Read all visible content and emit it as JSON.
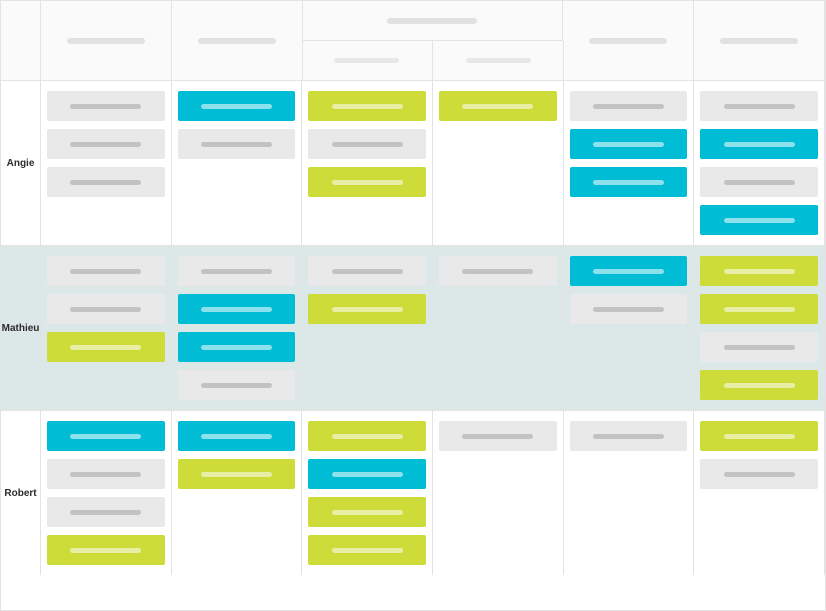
{
  "rowLabels": [
    "Angie",
    "Mathieu",
    "Robert"
  ],
  "highlightedRow": 1,
  "colors": {
    "gray": "#e9e9e9",
    "cyan": "#00bcd4",
    "lime": "#cddc39",
    "highlightBg": "#dbe8e7"
  },
  "header": {
    "top": [
      {
        "span": 1,
        "rowspan": 2
      },
      {
        "span": 1,
        "rowspan": 2
      },
      {
        "span": 2,
        "rowspan": 1
      },
      {
        "span": 1,
        "rowspan": 2
      },
      {
        "span": 1,
        "rowspan": 2
      }
    ],
    "sub": [
      {
        "col": 2
      },
      {
        "col": 3
      }
    ]
  },
  "grid": [
    [
      [
        "gray",
        "gray",
        "gray"
      ],
      [
        "cyan",
        "gray"
      ],
      [
        "lime",
        "gray",
        "lime"
      ],
      [
        "lime"
      ],
      [
        "gray",
        "cyan",
        "cyan"
      ],
      [
        "gray",
        "cyan",
        "gray",
        "cyan"
      ]
    ],
    [
      [
        "gray",
        "gray",
        "lime"
      ],
      [
        "gray",
        "cyan",
        "cyan",
        "gray"
      ],
      [
        "gray",
        "lime"
      ],
      [
        "gray"
      ],
      [
        "cyan",
        "gray"
      ],
      [
        "lime",
        "lime",
        "gray",
        "lime"
      ]
    ],
    [
      [
        "cyan",
        "gray",
        "gray",
        "lime"
      ],
      [
        "cyan",
        "lime"
      ],
      [
        "lime",
        "cyan",
        "lime",
        "lime"
      ],
      [
        "gray"
      ],
      [
        "gray"
      ],
      [
        "lime",
        "gray"
      ]
    ]
  ]
}
